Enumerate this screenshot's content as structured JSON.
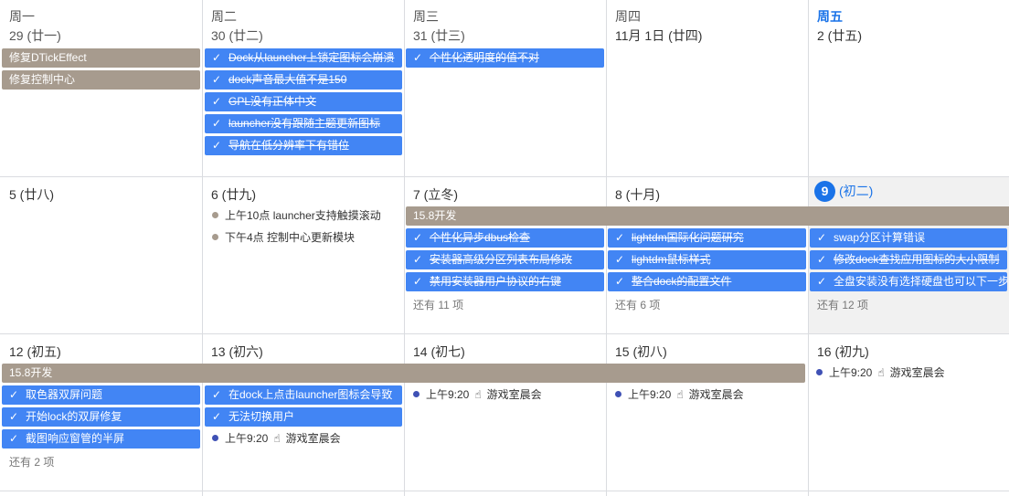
{
  "weekdays": [
    "周一",
    "周二",
    "周三",
    "周四",
    "周五"
  ],
  "row1": {
    "dates": [
      "29 (廿一)",
      "30 (廿二)",
      "31 (廿三)",
      "11月 1日 (廿四)",
      "2 (廿五)"
    ]
  },
  "row2": {
    "dates": [
      "5 (廿八)",
      "6 (廿九)",
      "7 (立冬)",
      "8 (十月)"
    ],
    "today_num": "9",
    "today_lunar": "(初二)"
  },
  "row3": {
    "dates": [
      "12 (初五)",
      "13 (初六)",
      "14 (初七)",
      "15 (初八)",
      "16 (初九)"
    ]
  },
  "events": {
    "fix_dtick": "修复DTickEffect",
    "fix_control": "修复控制中心",
    "dock_launcher_crash": "Dock从launcher上锁定图标会崩溃",
    "dock_volume": "dock声音最大值不是150",
    "gpl_chinese": "GPL没有正体中文",
    "launcher_theme_icon": "launcher没有跟随主题更新图标",
    "nav_low_res": "导航在低分辨率下有错位",
    "personal_transparency": "个性化透明度的值不对",
    "dev_15_8_a": "15.8开发",
    "personal_dbus": "个性化异步dbus检查",
    "installer_partition": "安装器高级分区列表布局修改",
    "installer_disable": "禁用安装器用户协议的右键",
    "lightdm_i18n": "lightdm国际化问题研究",
    "lightdm_cursor": "lightdm鼠标样式",
    "integrate_dock": "整合dock的配置文件",
    "swap_calc": "swap分区计算错误",
    "dock_find_icon": "修改dock查找应用图标的大小限制",
    "fulldisk_install": "全盘安装没有选择硬盘也可以下一步",
    "dev_15_8_b": "15.8开发",
    "color_picker": "取色器双屏问题",
    "lock_dual": "开始lock的双屏修复",
    "screenshot_half": "截图响应窗管的半屏",
    "dock_click_launcher": "在dock上点击launcher图标会导致",
    "cannot_switch": "无法切换用户"
  },
  "timed": {
    "launcher_touch_time": "上午10点",
    "launcher_touch_title": "launcher支持触摸滚动",
    "control_update_time": "下午4点",
    "control_update_title": "控制中心更新模块",
    "game_time": "上午9:20",
    "game_title": "游戏室晨会"
  },
  "more": {
    "wed_w2": "还有 11 项",
    "thu_w2": "还有 6 项",
    "fri_w2": "还有 12 项",
    "mon_w3": "还有 2 项"
  },
  "icons": {
    "check": "✓",
    "hand": "☝"
  },
  "colors": {
    "event_blue": "#4285f4",
    "event_gray": "#a79b8e",
    "today_blue": "#1a73e8"
  }
}
